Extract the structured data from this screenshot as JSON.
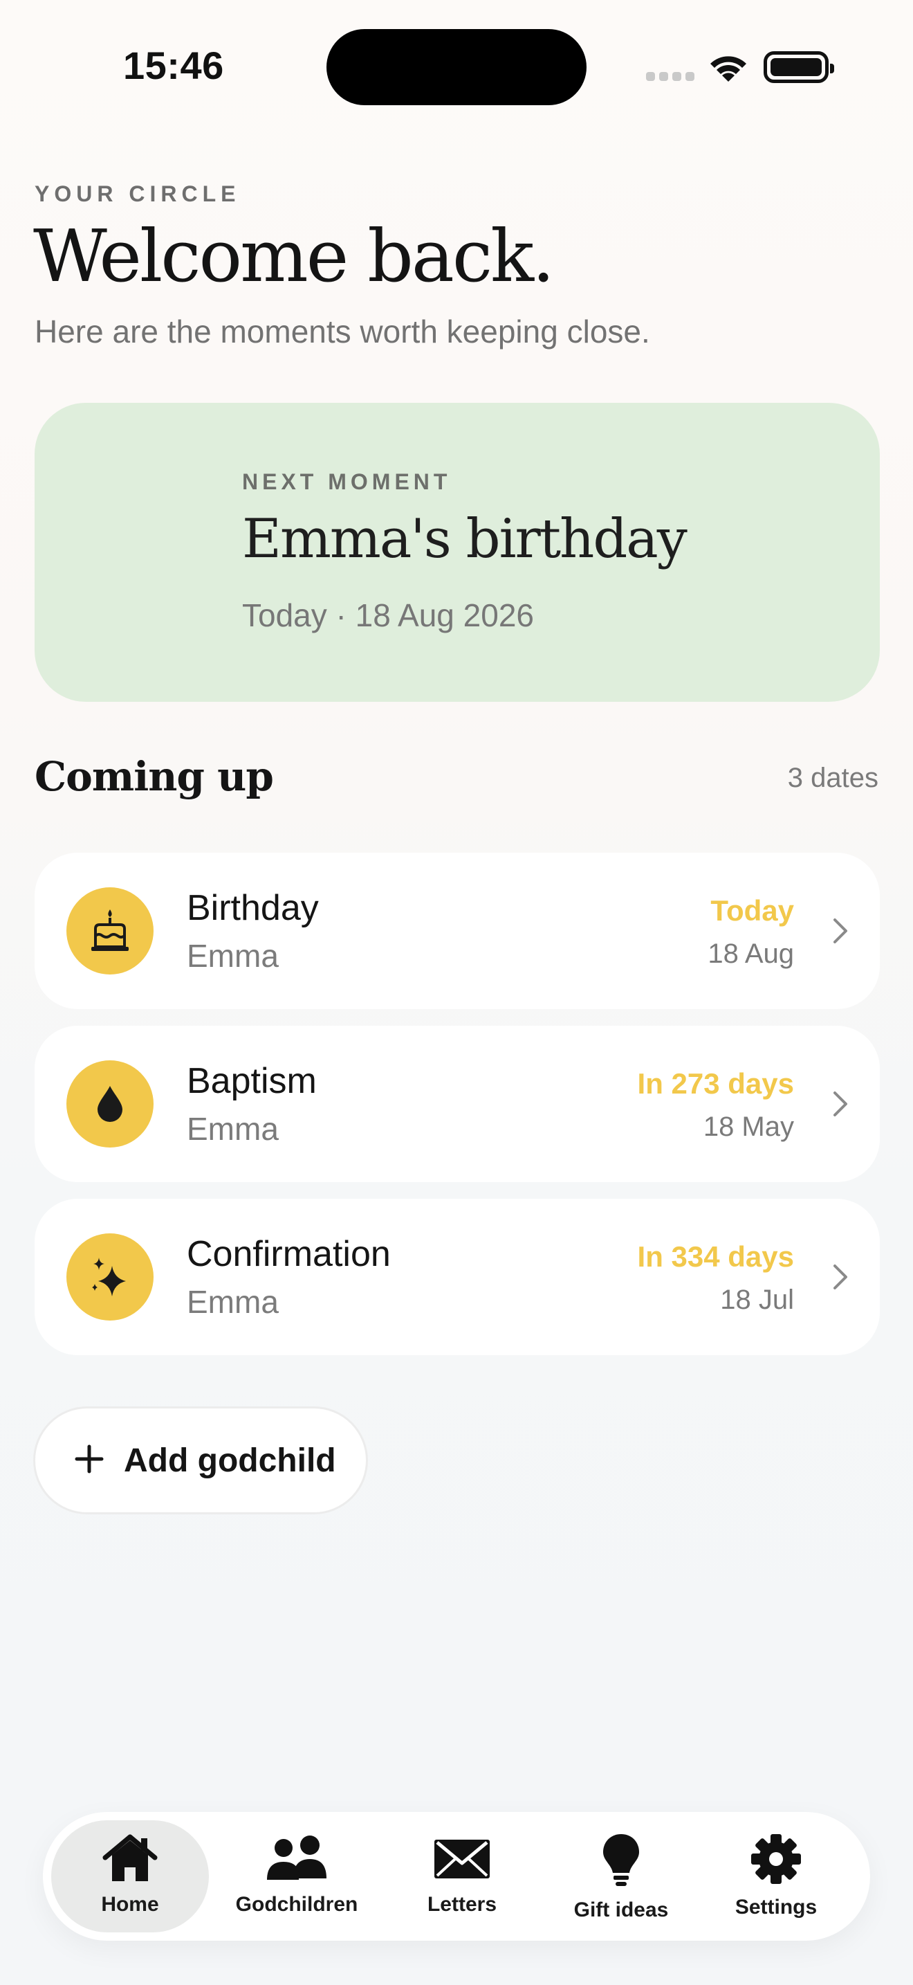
{
  "status_bar": {
    "time": "15:46"
  },
  "header": {
    "eyebrow": "YOUR CIRCLE",
    "title": "Welcome back.",
    "subtitle": "Here are the moments worth keeping close."
  },
  "hero": {
    "eyebrow": "NEXT MOMENT",
    "title": "Emma's birthday",
    "date": "Today · 18 Aug 2026",
    "background_color": "#dfeedc"
  },
  "coming_up": {
    "title": "Coming up",
    "count": "3 dates",
    "items": [
      {
        "icon": "cake-icon",
        "title": "Birthday",
        "person": "Emma",
        "relative": "Today",
        "date": "18 Aug"
      },
      {
        "icon": "drop-icon",
        "title": "Baptism",
        "person": "Emma",
        "relative": "In 273 days",
        "date": "18 May"
      },
      {
        "icon": "sparkles-icon",
        "title": "Confirmation",
        "person": "Emma",
        "relative": "In 334 days",
        "date": "18 Jul"
      }
    ]
  },
  "add_button": {
    "label": "Add godchild",
    "icon": "plus-icon"
  },
  "tab_bar": {
    "tabs": [
      {
        "icon": "home-icon",
        "label": "Home",
        "active": true
      },
      {
        "icon": "people-icon",
        "label": "Godchildren",
        "active": false
      },
      {
        "icon": "envelope-icon",
        "label": "Letters",
        "active": false
      },
      {
        "icon": "lightbulb-icon",
        "label": "Gift ideas",
        "active": false
      },
      {
        "icon": "gear-icon",
        "label": "Settings",
        "active": false
      }
    ]
  },
  "colors": {
    "accent": "#f2c84b",
    "text_primary": "#151515",
    "text_secondary": "#7a7a7a",
    "card": "#ffffff"
  }
}
